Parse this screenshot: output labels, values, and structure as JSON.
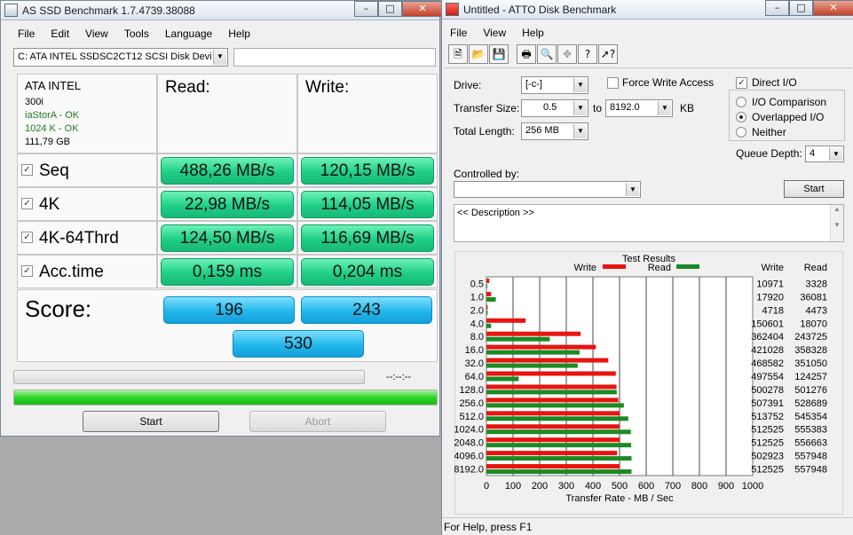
{
  "asssd": {
    "title": "AS SSD Benchmark 1.7.4739.38088",
    "menu": [
      "File",
      "Edit",
      "View",
      "Tools",
      "Language",
      "Help"
    ],
    "drive_select": "C: ATA INTEL SSDSC2CT12 SCSI Disk Devi",
    "drive_info": {
      "model": "ATA INTEL",
      "firmware": "300i",
      "driver": "iaStorA - OK",
      "alignment": "1024 K - OK",
      "size": "111,79 GB"
    },
    "headers": {
      "read": "Read:",
      "write": "Write:"
    },
    "rows": [
      {
        "label": "Seq",
        "read": "488,26 MB/s",
        "write": "120,15 MB/s"
      },
      {
        "label": "4K",
        "read": "22,98 MB/s",
        "write": "114,05 MB/s"
      },
      {
        "label": "4K-64Thrd",
        "read": "124,50 MB/s",
        "write": "116,69 MB/s"
      },
      {
        "label": "Acc.time",
        "read": "0,159 ms",
        "write": "0,204 ms"
      }
    ],
    "score": {
      "label": "Score:",
      "read": "196",
      "write": "243",
      "total": "530"
    },
    "time_display": "--:--:--",
    "progress_fraction": 1.0,
    "buttons": {
      "start": "Start",
      "abort": "Abort"
    },
    "colors": {
      "result": "#1fcf86",
      "score": "#22b7ec",
      "ok_text": "#1e7a1e"
    }
  },
  "atto": {
    "title": "Untitled - ATTO Disk Benchmark",
    "menu": [
      "File",
      "View",
      "Help"
    ],
    "drive_label": "Drive:",
    "drive_value": "[-c-]",
    "force_write_label": "Force Write Access",
    "direct_io_label": "Direct I/O",
    "transfer_size_label": "Transfer Size:",
    "transfer_from": "0.5",
    "to_label": "to",
    "transfer_to": "8192.0",
    "kb_label": "KB",
    "total_length_label": "Total Length:",
    "total_length_value": "256 MB",
    "io_options": [
      "I/O Comparison",
      "Overlapped I/O",
      "Neither"
    ],
    "queue_depth_label": "Queue Depth:",
    "queue_depth_value": "4",
    "controlled_by_label": "Controlled by:",
    "start_label": "Start",
    "description": "<< Description >>",
    "status": "For Help, press F1"
  },
  "chart_data": {
    "type": "bar",
    "orientation": "horizontal",
    "title": "Test Results",
    "xlabel": "Transfer Rate - MB / Sec",
    "xlim": [
      0,
      1000
    ],
    "xticks": [
      "0",
      "100",
      "200",
      "300",
      "400",
      "500",
      "600",
      "700",
      "800",
      "900",
      "1000"
    ],
    "grid": true,
    "legend": "top",
    "categories": [
      "0.5",
      "1.0",
      "2.0",
      "4.0",
      "8.0",
      "16.0",
      "32.0",
      "64.0",
      "128.0",
      "256.0",
      "512.0",
      "1024.0",
      "2048.0",
      "4096.0",
      "8192.0"
    ],
    "series": [
      {
        "name": "Write",
        "color": "#e8140f",
        "values": [
          10.7,
          17.5,
          4.6,
          147.1,
          353.8,
          411.2,
          457.6,
          485.9,
          488.5,
          495.5,
          501.7,
          500.5,
          500.5,
          491.1,
          500.5
        ]
      },
      {
        "name": "Read",
        "color": "#1b8a23",
        "values": [
          3.2,
          35.2,
          4.4,
          17.6,
          238.0,
          349.9,
          342.8,
          121.4,
          489.5,
          516.2,
          532.6,
          542.4,
          543.6,
          544.9,
          544.9
        ]
      }
    ],
    "table_headers": [
      "Write",
      "Read"
    ],
    "table": [
      [
        "10971",
        "3328"
      ],
      [
        "17920",
        "36081"
      ],
      [
        "4718",
        "4473"
      ],
      [
        "150601",
        "18070"
      ],
      [
        "362404",
        "243725"
      ],
      [
        "421028",
        "358328"
      ],
      [
        "468582",
        "351050"
      ],
      [
        "497554",
        "124257"
      ],
      [
        "500278",
        "501276"
      ],
      [
        "507391",
        "528689"
      ],
      [
        "513752",
        "545354"
      ],
      [
        "512525",
        "555383"
      ],
      [
        "512525",
        "556663"
      ],
      [
        "502923",
        "557948"
      ],
      [
        "512525",
        "557948"
      ]
    ]
  }
}
